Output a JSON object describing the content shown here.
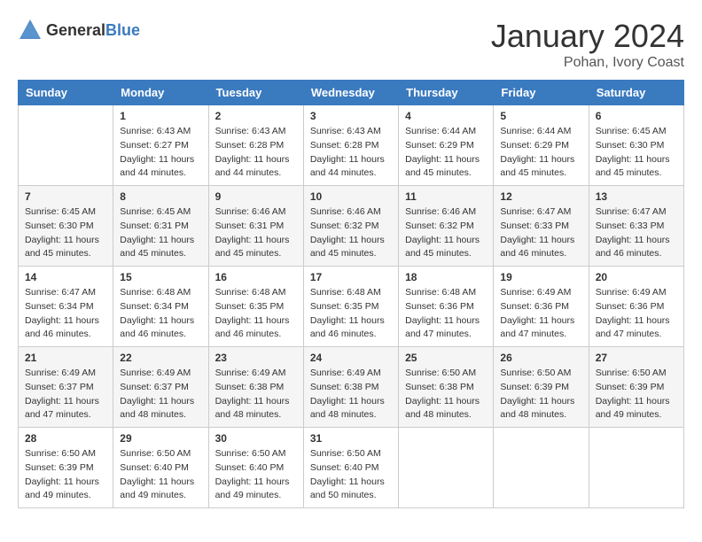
{
  "header": {
    "logo_general": "General",
    "logo_blue": "Blue",
    "title": "January 2024",
    "subtitle": "Pohan, Ivory Coast"
  },
  "calendar": {
    "days_of_week": [
      "Sunday",
      "Monday",
      "Tuesday",
      "Wednesday",
      "Thursday",
      "Friday",
      "Saturday"
    ],
    "rows": [
      [
        {
          "day": "",
          "sunrise": "",
          "sunset": "",
          "daylight": ""
        },
        {
          "day": "1",
          "sunrise": "Sunrise: 6:43 AM",
          "sunset": "Sunset: 6:27 PM",
          "daylight": "Daylight: 11 hours and 44 minutes."
        },
        {
          "day": "2",
          "sunrise": "Sunrise: 6:43 AM",
          "sunset": "Sunset: 6:28 PM",
          "daylight": "Daylight: 11 hours and 44 minutes."
        },
        {
          "day": "3",
          "sunrise": "Sunrise: 6:43 AM",
          "sunset": "Sunset: 6:28 PM",
          "daylight": "Daylight: 11 hours and 44 minutes."
        },
        {
          "day": "4",
          "sunrise": "Sunrise: 6:44 AM",
          "sunset": "Sunset: 6:29 PM",
          "daylight": "Daylight: 11 hours and 45 minutes."
        },
        {
          "day": "5",
          "sunrise": "Sunrise: 6:44 AM",
          "sunset": "Sunset: 6:29 PM",
          "daylight": "Daylight: 11 hours and 45 minutes."
        },
        {
          "day": "6",
          "sunrise": "Sunrise: 6:45 AM",
          "sunset": "Sunset: 6:30 PM",
          "daylight": "Daylight: 11 hours and 45 minutes."
        }
      ],
      [
        {
          "day": "7",
          "sunrise": "Sunrise: 6:45 AM",
          "sunset": "Sunset: 6:30 PM",
          "daylight": "Daylight: 11 hours and 45 minutes."
        },
        {
          "day": "8",
          "sunrise": "Sunrise: 6:45 AM",
          "sunset": "Sunset: 6:31 PM",
          "daylight": "Daylight: 11 hours and 45 minutes."
        },
        {
          "day": "9",
          "sunrise": "Sunrise: 6:46 AM",
          "sunset": "Sunset: 6:31 PM",
          "daylight": "Daylight: 11 hours and 45 minutes."
        },
        {
          "day": "10",
          "sunrise": "Sunrise: 6:46 AM",
          "sunset": "Sunset: 6:32 PM",
          "daylight": "Daylight: 11 hours and 45 minutes."
        },
        {
          "day": "11",
          "sunrise": "Sunrise: 6:46 AM",
          "sunset": "Sunset: 6:32 PM",
          "daylight": "Daylight: 11 hours and 45 minutes."
        },
        {
          "day": "12",
          "sunrise": "Sunrise: 6:47 AM",
          "sunset": "Sunset: 6:33 PM",
          "daylight": "Daylight: 11 hours and 46 minutes."
        },
        {
          "day": "13",
          "sunrise": "Sunrise: 6:47 AM",
          "sunset": "Sunset: 6:33 PM",
          "daylight": "Daylight: 11 hours and 46 minutes."
        }
      ],
      [
        {
          "day": "14",
          "sunrise": "Sunrise: 6:47 AM",
          "sunset": "Sunset: 6:34 PM",
          "daylight": "Daylight: 11 hours and 46 minutes."
        },
        {
          "day": "15",
          "sunrise": "Sunrise: 6:48 AM",
          "sunset": "Sunset: 6:34 PM",
          "daylight": "Daylight: 11 hours and 46 minutes."
        },
        {
          "day": "16",
          "sunrise": "Sunrise: 6:48 AM",
          "sunset": "Sunset: 6:35 PM",
          "daylight": "Daylight: 11 hours and 46 minutes."
        },
        {
          "day": "17",
          "sunrise": "Sunrise: 6:48 AM",
          "sunset": "Sunset: 6:35 PM",
          "daylight": "Daylight: 11 hours and 46 minutes."
        },
        {
          "day": "18",
          "sunrise": "Sunrise: 6:48 AM",
          "sunset": "Sunset: 6:36 PM",
          "daylight": "Daylight: 11 hours and 47 minutes."
        },
        {
          "day": "19",
          "sunrise": "Sunrise: 6:49 AM",
          "sunset": "Sunset: 6:36 PM",
          "daylight": "Daylight: 11 hours and 47 minutes."
        },
        {
          "day": "20",
          "sunrise": "Sunrise: 6:49 AM",
          "sunset": "Sunset: 6:36 PM",
          "daylight": "Daylight: 11 hours and 47 minutes."
        }
      ],
      [
        {
          "day": "21",
          "sunrise": "Sunrise: 6:49 AM",
          "sunset": "Sunset: 6:37 PM",
          "daylight": "Daylight: 11 hours and 47 minutes."
        },
        {
          "day": "22",
          "sunrise": "Sunrise: 6:49 AM",
          "sunset": "Sunset: 6:37 PM",
          "daylight": "Daylight: 11 hours and 48 minutes."
        },
        {
          "day": "23",
          "sunrise": "Sunrise: 6:49 AM",
          "sunset": "Sunset: 6:38 PM",
          "daylight": "Daylight: 11 hours and 48 minutes."
        },
        {
          "day": "24",
          "sunrise": "Sunrise: 6:49 AM",
          "sunset": "Sunset: 6:38 PM",
          "daylight": "Daylight: 11 hours and 48 minutes."
        },
        {
          "day": "25",
          "sunrise": "Sunrise: 6:50 AM",
          "sunset": "Sunset: 6:38 PM",
          "daylight": "Daylight: 11 hours and 48 minutes."
        },
        {
          "day": "26",
          "sunrise": "Sunrise: 6:50 AM",
          "sunset": "Sunset: 6:39 PM",
          "daylight": "Daylight: 11 hours and 48 minutes."
        },
        {
          "day": "27",
          "sunrise": "Sunrise: 6:50 AM",
          "sunset": "Sunset: 6:39 PM",
          "daylight": "Daylight: 11 hours and 49 minutes."
        }
      ],
      [
        {
          "day": "28",
          "sunrise": "Sunrise: 6:50 AM",
          "sunset": "Sunset: 6:39 PM",
          "daylight": "Daylight: 11 hours and 49 minutes."
        },
        {
          "day": "29",
          "sunrise": "Sunrise: 6:50 AM",
          "sunset": "Sunset: 6:40 PM",
          "daylight": "Daylight: 11 hours and 49 minutes."
        },
        {
          "day": "30",
          "sunrise": "Sunrise: 6:50 AM",
          "sunset": "Sunset: 6:40 PM",
          "daylight": "Daylight: 11 hours and 49 minutes."
        },
        {
          "day": "31",
          "sunrise": "Sunrise: 6:50 AM",
          "sunset": "Sunset: 6:40 PM",
          "daylight": "Daylight: 11 hours and 50 minutes."
        },
        {
          "day": "",
          "sunrise": "",
          "sunset": "",
          "daylight": ""
        },
        {
          "day": "",
          "sunrise": "",
          "sunset": "",
          "daylight": ""
        },
        {
          "day": "",
          "sunrise": "",
          "sunset": "",
          "daylight": ""
        }
      ]
    ]
  }
}
